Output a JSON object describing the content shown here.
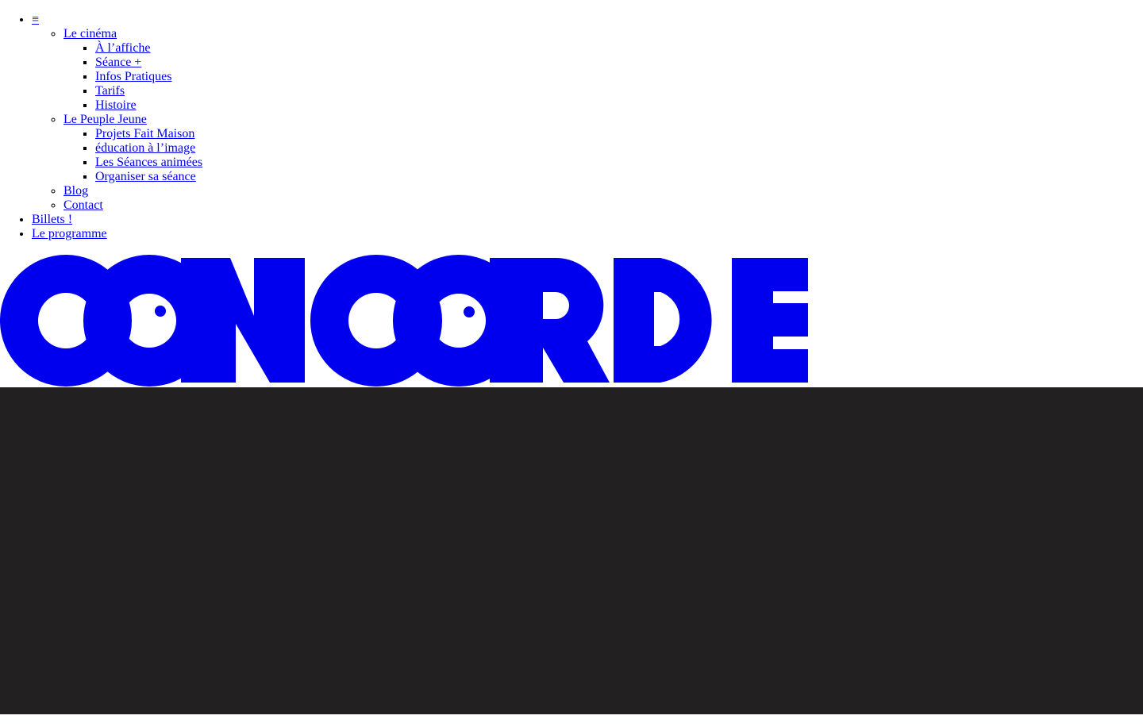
{
  "nav": {
    "menu_toggle": "≡",
    "cinema": {
      "label": "Le cinéma",
      "items": [
        "À l’affiche",
        "Séance +",
        "Infos Pratiques",
        "Tarifs",
        "Histoire"
      ]
    },
    "peuple": {
      "label": "Le Peuple Jeune",
      "items": [
        "Projets Fait Maison",
        "éducation à l’image",
        "Les Séances animées",
        "Organiser sa séance"
      ]
    },
    "blog": "Blog",
    "contact": "Contact",
    "billets": "Billets  !",
    "programme": "Le programme"
  },
  "logo": {
    "alt": "CONCORDE",
    "color": "#0000ee"
  },
  "colors": {
    "dark_band": "#232021",
    "link": "#0000ee"
  }
}
